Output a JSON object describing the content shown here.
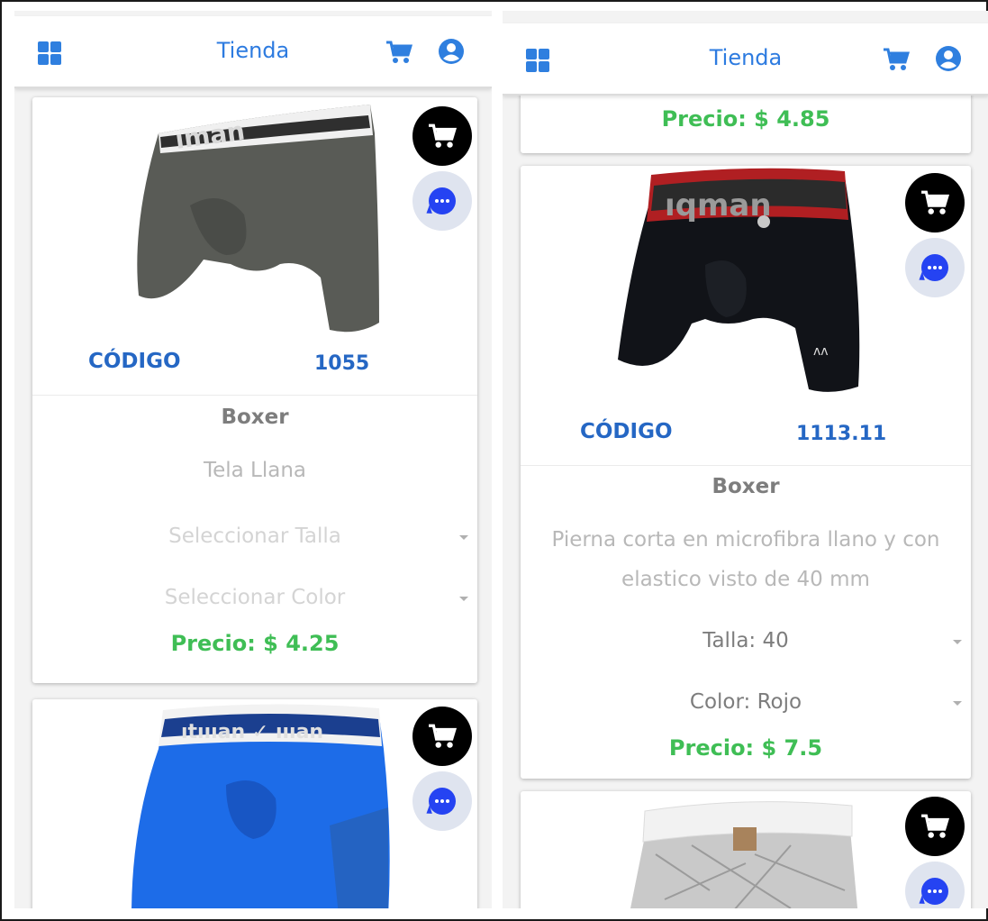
{
  "app": {
    "title": "Tienda",
    "accent_color": "#2d7be0",
    "price_color": "#3fbe55",
    "icons": {
      "menu": "grid-icon",
      "cart": "cart-icon",
      "account": "account-icon",
      "chat": "chat-icon"
    }
  },
  "left_panel": {
    "products": [
      {
        "code_label": "CÓDIGO",
        "code": "1055",
        "name": "Boxer",
        "description": "Tela Llana",
        "size_select": "Seleccionar Talla",
        "color_select": "Seleccionar Color",
        "price": "Precio: $ 4.25",
        "image": "gray-boxer-image"
      },
      {
        "image": "blue-long-boxer-image"
      }
    ]
  },
  "right_panel": {
    "products": [
      {
        "price": "Precio: $ 4.85"
      },
      {
        "code_label": "CÓDIGO",
        "code": "1113.11",
        "name": "Boxer",
        "description": "Pierna corta en microfibra llano y con elastico visto de 40 mm",
        "size_select": "Talla: 40",
        "color_select": "Color: Rojo",
        "price": "Precio: $ 7.5",
        "image": "black-red-boxer-image"
      },
      {
        "image": "white-patterned-boxer-image"
      }
    ]
  }
}
